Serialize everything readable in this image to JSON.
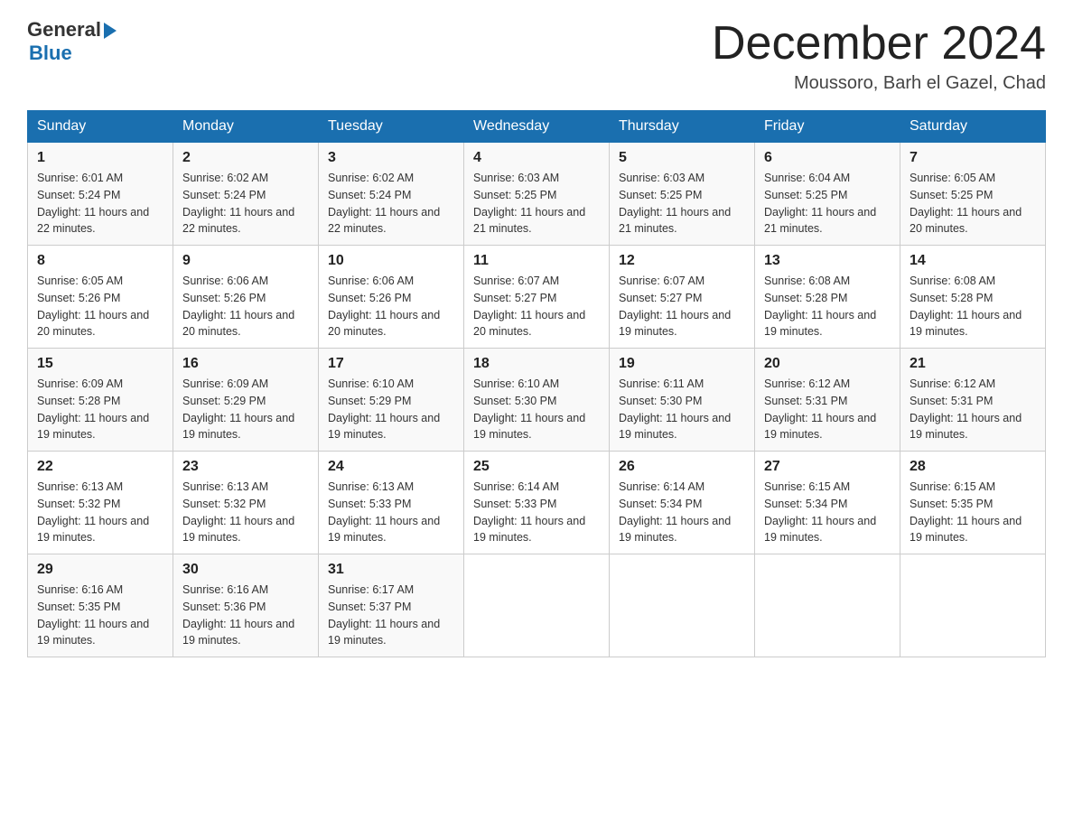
{
  "header": {
    "logo_general": "General",
    "logo_blue": "Blue",
    "month_title": "December 2024",
    "location": "Moussoro, Barh el Gazel, Chad"
  },
  "weekdays": [
    "Sunday",
    "Monday",
    "Tuesday",
    "Wednesday",
    "Thursday",
    "Friday",
    "Saturday"
  ],
  "weeks": [
    [
      {
        "day": "1",
        "sunrise": "6:01 AM",
        "sunset": "5:24 PM",
        "daylight": "11 hours and 22 minutes."
      },
      {
        "day": "2",
        "sunrise": "6:02 AM",
        "sunset": "5:24 PM",
        "daylight": "11 hours and 22 minutes."
      },
      {
        "day": "3",
        "sunrise": "6:02 AM",
        "sunset": "5:24 PM",
        "daylight": "11 hours and 22 minutes."
      },
      {
        "day": "4",
        "sunrise": "6:03 AM",
        "sunset": "5:25 PM",
        "daylight": "11 hours and 21 minutes."
      },
      {
        "day": "5",
        "sunrise": "6:03 AM",
        "sunset": "5:25 PM",
        "daylight": "11 hours and 21 minutes."
      },
      {
        "day": "6",
        "sunrise": "6:04 AM",
        "sunset": "5:25 PM",
        "daylight": "11 hours and 21 minutes."
      },
      {
        "day": "7",
        "sunrise": "6:05 AM",
        "sunset": "5:25 PM",
        "daylight": "11 hours and 20 minutes."
      }
    ],
    [
      {
        "day": "8",
        "sunrise": "6:05 AM",
        "sunset": "5:26 PM",
        "daylight": "11 hours and 20 minutes."
      },
      {
        "day": "9",
        "sunrise": "6:06 AM",
        "sunset": "5:26 PM",
        "daylight": "11 hours and 20 minutes."
      },
      {
        "day": "10",
        "sunrise": "6:06 AM",
        "sunset": "5:26 PM",
        "daylight": "11 hours and 20 minutes."
      },
      {
        "day": "11",
        "sunrise": "6:07 AM",
        "sunset": "5:27 PM",
        "daylight": "11 hours and 20 minutes."
      },
      {
        "day": "12",
        "sunrise": "6:07 AM",
        "sunset": "5:27 PM",
        "daylight": "11 hours and 19 minutes."
      },
      {
        "day": "13",
        "sunrise": "6:08 AM",
        "sunset": "5:28 PM",
        "daylight": "11 hours and 19 minutes."
      },
      {
        "day": "14",
        "sunrise": "6:08 AM",
        "sunset": "5:28 PM",
        "daylight": "11 hours and 19 minutes."
      }
    ],
    [
      {
        "day": "15",
        "sunrise": "6:09 AM",
        "sunset": "5:28 PM",
        "daylight": "11 hours and 19 minutes."
      },
      {
        "day": "16",
        "sunrise": "6:09 AM",
        "sunset": "5:29 PM",
        "daylight": "11 hours and 19 minutes."
      },
      {
        "day": "17",
        "sunrise": "6:10 AM",
        "sunset": "5:29 PM",
        "daylight": "11 hours and 19 minutes."
      },
      {
        "day": "18",
        "sunrise": "6:10 AM",
        "sunset": "5:30 PM",
        "daylight": "11 hours and 19 minutes."
      },
      {
        "day": "19",
        "sunrise": "6:11 AM",
        "sunset": "5:30 PM",
        "daylight": "11 hours and 19 minutes."
      },
      {
        "day": "20",
        "sunrise": "6:12 AM",
        "sunset": "5:31 PM",
        "daylight": "11 hours and 19 minutes."
      },
      {
        "day": "21",
        "sunrise": "6:12 AM",
        "sunset": "5:31 PM",
        "daylight": "11 hours and 19 minutes."
      }
    ],
    [
      {
        "day": "22",
        "sunrise": "6:13 AM",
        "sunset": "5:32 PM",
        "daylight": "11 hours and 19 minutes."
      },
      {
        "day": "23",
        "sunrise": "6:13 AM",
        "sunset": "5:32 PM",
        "daylight": "11 hours and 19 minutes."
      },
      {
        "day": "24",
        "sunrise": "6:13 AM",
        "sunset": "5:33 PM",
        "daylight": "11 hours and 19 minutes."
      },
      {
        "day": "25",
        "sunrise": "6:14 AM",
        "sunset": "5:33 PM",
        "daylight": "11 hours and 19 minutes."
      },
      {
        "day": "26",
        "sunrise": "6:14 AM",
        "sunset": "5:34 PM",
        "daylight": "11 hours and 19 minutes."
      },
      {
        "day": "27",
        "sunrise": "6:15 AM",
        "sunset": "5:34 PM",
        "daylight": "11 hours and 19 minutes."
      },
      {
        "day": "28",
        "sunrise": "6:15 AM",
        "sunset": "5:35 PM",
        "daylight": "11 hours and 19 minutes."
      }
    ],
    [
      {
        "day": "29",
        "sunrise": "6:16 AM",
        "sunset": "5:35 PM",
        "daylight": "11 hours and 19 minutes."
      },
      {
        "day": "30",
        "sunrise": "6:16 AM",
        "sunset": "5:36 PM",
        "daylight": "11 hours and 19 minutes."
      },
      {
        "day": "31",
        "sunrise": "6:17 AM",
        "sunset": "5:37 PM",
        "daylight": "11 hours and 19 minutes."
      },
      null,
      null,
      null,
      null
    ]
  ]
}
